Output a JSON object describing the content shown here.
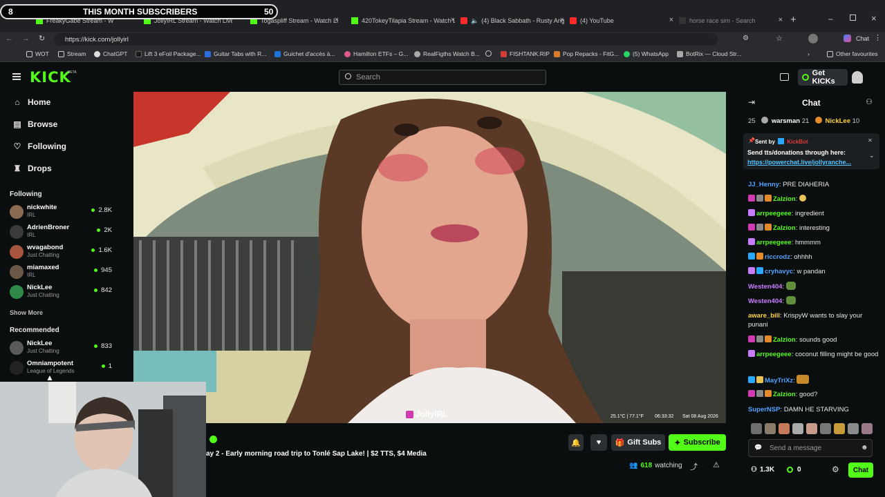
{
  "overlay": {
    "left_count": "8",
    "title": "THIS MONTH SUBSCRIBERS",
    "right_count": "50"
  },
  "tabs": [
    {
      "label": "FreakyGabe Stream - Watch L"
    },
    {
      "label": "JollyIRL Stream - Watch Live"
    },
    {
      "label": "Togaspliff Stream - Watch Li"
    },
    {
      "label": "420TokeyTilapia Stream - Watch Li"
    },
    {
      "label": "(4) Black Sabbath - Rusty Ang"
    },
    {
      "label": "(4) YouTube"
    },
    {
      "label": "horse race sim - Search"
    }
  ],
  "address": {
    "url": "https://kick.com/jollyirl"
  },
  "bookmarks": [
    "WOT",
    "Stream",
    "ChatGPT",
    "Lift 3 eFoil Package...",
    "Guitar Tabs with R...",
    "Guichet d'accès à...",
    "Hamilton ETFs – G...",
    "RealFigths Watch B...",
    "FISHTANK.RIP",
    "Pop Repacks - FitG...",
    "(5) WhatsApp",
    "BotRix — Cloud Str...",
    "Other favourites"
  ],
  "header": {
    "logo": "KICK",
    "beta": "BETA",
    "search_placeholder": "Search",
    "get_kicks": "Get KICKs"
  },
  "nav": {
    "home": "Home",
    "browse": "Browse",
    "following": "Following",
    "drops": "Drops"
  },
  "sidebar": {
    "following_title": "Following",
    "following": [
      {
        "name": "nickwhite",
        "category": "IRL",
        "viewers": "2.8K"
      },
      {
        "name": "AdrienBroner",
        "category": "IRL",
        "viewers": "2K"
      },
      {
        "name": "wvagabond",
        "category": "Just Chatting",
        "viewers": "1.6K"
      },
      {
        "name": "miamaxed",
        "category": "IRL",
        "viewers": "945"
      },
      {
        "name": "NickLee",
        "category": "Just Chatting",
        "viewers": "842"
      }
    ],
    "show_more": "Show More",
    "recommended_title": "Recommended",
    "recommended": [
      {
        "name": "NickLee",
        "category": "Just Chatting",
        "viewers": "833"
      },
      {
        "name": "Omniampotent",
        "category": "League of Legends",
        "viewers": "1"
      }
    ]
  },
  "video": {
    "watermark": "JollyIRL",
    "overlay_temp": "25.1°C | 77.1°F",
    "overlay_time": "06:33:32",
    "overlay_date": "Sat 08 Aug 2026"
  },
  "stream": {
    "title": "ay 2 - Early morning road trip to Tonlé Sap Lake! | $2 TTS, $4 Media",
    "gift_subs": "Gift Subs",
    "subscribe": "Subscribe",
    "watching_count": "618",
    "watching_label": "watching"
  },
  "chat": {
    "title": "Chat",
    "leaderboard": [
      {
        "rank": "25",
        "name": "",
        "count": ""
      },
      {
        "rank": "",
        "name": "warsman",
        "count": "21"
      },
      {
        "rank": "",
        "name": "NickLee",
        "count": "10"
      }
    ],
    "pinned": {
      "sent_by_label": "Sent by",
      "sender": "KickBot",
      "text": "Send tts/donations through here:",
      "link": "https://powerchat.live/jollyranche..."
    },
    "messages": [
      {
        "user": "JJ_Henny",
        "text": "PRE DIAHERIA",
        "color": "#4fa3ff"
      },
      {
        "user": "Zalzion",
        "text": "",
        "color": "#53fc18"
      },
      {
        "user": "arrpeegeee",
        "text": "ingredient",
        "color": "#53fc18"
      },
      {
        "user": "Zalzion",
        "text": "interesting",
        "color": "#53fc18"
      },
      {
        "user": "arrpeegeee",
        "text": "hmmmm",
        "color": "#53fc18"
      },
      {
        "user": "riccrodz",
        "text": "ohhhh",
        "color": "#4fa3ff"
      },
      {
        "user": "cryhavyc",
        "text": "w pandan",
        "color": "#4fa3ff"
      },
      {
        "user": "Westen404",
        "text": "",
        "color": "#c77dff"
      },
      {
        "user": "Westen404",
        "text": "",
        "color": "#c77dff"
      },
      {
        "user": "aware_bill",
        "text": "KrispyW wants to slay your punani",
        "color": "#ffd43b"
      },
      {
        "user": "Zalzion",
        "text": "sounds good",
        "color": "#53fc18"
      },
      {
        "user": "arrpeegeee",
        "text": "coconut filling might be good",
        "color": "#53fc18"
      },
      {
        "user": "MayTriXz",
        "text": "",
        "color": "#4fa3ff"
      },
      {
        "user": "Zalzion",
        "text": "good?",
        "color": "#53fc18"
      },
      {
        "user": "SuperNSP",
        "text": "DAMN HE STARVING",
        "color": "#4fa3ff"
      }
    ],
    "input_placeholder": "Send a message",
    "points_a": "1.3K",
    "points_b": "0",
    "send_button": "Chat"
  }
}
